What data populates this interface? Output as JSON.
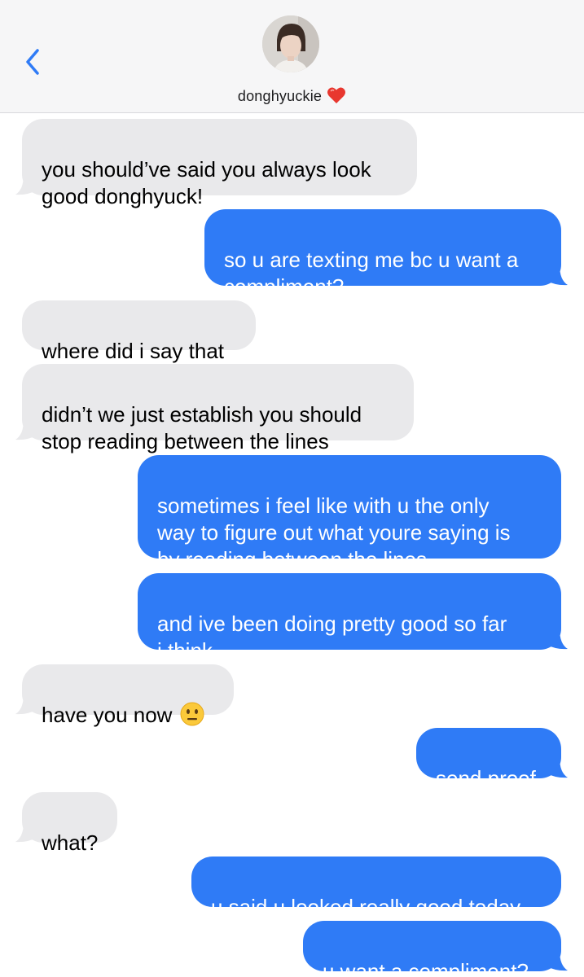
{
  "header": {
    "back_icon": "chevron-left-icon",
    "contact_name": "donghyuckie",
    "name_emoji": "heart-icon",
    "accent_color": "#2f7bf6"
  },
  "messages": [
    {
      "direction": "incoming",
      "text": "you should’ve said you always look\ngood donghyuck!"
    },
    {
      "direction": "outgoing",
      "text": "so u are texting me bc u want a\ncompliment?"
    },
    {
      "direction": "incoming",
      "text": "where did i say that"
    },
    {
      "direction": "incoming",
      "text": "didn’t we just establish you should\nstop reading between the lines"
    },
    {
      "direction": "outgoing",
      "text": "sometimes i feel like with u the only\nway to figure out what youre saying is\nby reading between the lines"
    },
    {
      "direction": "outgoing",
      "text": "and ive been doing pretty good so far\ni think"
    },
    {
      "direction": "incoming",
      "text": "have you now",
      "emoji": "neutral-face-icon"
    },
    {
      "direction": "outgoing",
      "text": "send proof"
    },
    {
      "direction": "incoming",
      "text": "what?"
    },
    {
      "direction": "outgoing",
      "text": "u said u looked really good today"
    },
    {
      "direction": "outgoing",
      "text": "u want a compliment?"
    }
  ],
  "colors": {
    "incoming_bubble": "#e9e9eb",
    "outgoing_bubble": "#2f7bf6",
    "header_bg": "#f6f6f7"
  }
}
